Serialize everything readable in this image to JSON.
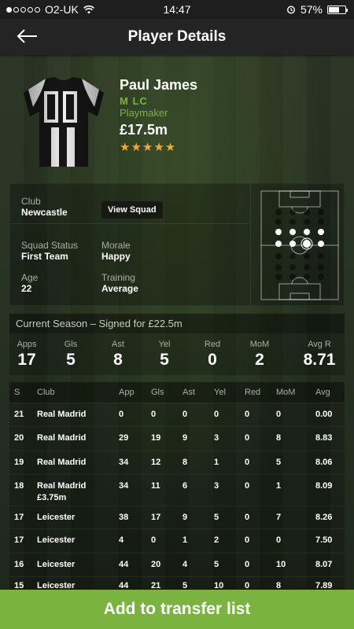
{
  "status_bar": {
    "carrier": "O2-UK",
    "time": "14:47",
    "battery": "57%"
  },
  "nav": {
    "title": "Player Details"
  },
  "player": {
    "shirt_number": "11",
    "name": "Paul James",
    "position": "M LC",
    "role": "Playmaker",
    "value": "£17.5m",
    "rating_stars": "★★★★★"
  },
  "info": {
    "club_label": "Club",
    "club": "Newcastle",
    "view_squad": "View Squad",
    "squad_status_label": "Squad Status",
    "squad_status": "First Team",
    "morale_label": "Morale",
    "morale": "Happy",
    "age_label": "Age",
    "age": "22",
    "training_label": "Training",
    "training": "Average"
  },
  "season": {
    "heading": "Current Season – Signed for £22.5m",
    "stats": [
      {
        "label": "Apps",
        "value": "17"
      },
      {
        "label": "Gls",
        "value": "5"
      },
      {
        "label": "Ast",
        "value": "8"
      },
      {
        "label": "Yel",
        "value": "5"
      },
      {
        "label": "Red",
        "value": "0"
      },
      {
        "label": "MoM",
        "value": "2"
      },
      {
        "label": "Avg R",
        "value": "8.71"
      }
    ]
  },
  "history": {
    "headers": {
      "s": "S",
      "club": "Club",
      "app": "App",
      "gls": "Gls",
      "ast": "Ast",
      "yel": "Yel",
      "red": "Red",
      "mom": "MoM",
      "avg": "Avg"
    },
    "rows": [
      {
        "s": "21",
        "club": "Real Madrid",
        "fee": "",
        "app": "0",
        "gls": "0",
        "ast": "0",
        "yel": "0",
        "red": "0",
        "mom": "0",
        "avg": "0.00"
      },
      {
        "s": "20",
        "club": "Real Madrid",
        "fee": "",
        "app": "29",
        "gls": "19",
        "ast": "9",
        "yel": "3",
        "red": "0",
        "mom": "8",
        "avg": "8.83"
      },
      {
        "s": "19",
        "club": "Real Madrid",
        "fee": "",
        "app": "34",
        "gls": "12",
        "ast": "8",
        "yel": "1",
        "red": "0",
        "mom": "5",
        "avg": "8.06"
      },
      {
        "s": "18",
        "club": "Real Madrid",
        "fee": "£3.75m",
        "app": "34",
        "gls": "11",
        "ast": "6",
        "yel": "3",
        "red": "0",
        "mom": "1",
        "avg": "8.09"
      },
      {
        "s": "17",
        "club": "Leicester",
        "fee": "",
        "app": "38",
        "gls": "17",
        "ast": "9",
        "yel": "5",
        "red": "0",
        "mom": "7",
        "avg": "8.26"
      },
      {
        "s": "17",
        "club": "Leicester",
        "fee": "",
        "app": "4",
        "gls": "0",
        "ast": "1",
        "yel": "2",
        "red": "0",
        "mom": "0",
        "avg": "7.50"
      },
      {
        "s": "16",
        "club": "Leicester",
        "fee": "",
        "app": "44",
        "gls": "20",
        "ast": "4",
        "yel": "5",
        "red": "0",
        "mom": "10",
        "avg": "8.07"
      },
      {
        "s": "15",
        "club": "Leicester",
        "fee": "",
        "app": "44",
        "gls": "21",
        "ast": "5",
        "yel": "10",
        "red": "0",
        "mom": "8",
        "avg": "7.89"
      }
    ]
  },
  "actions": {
    "add_to_transfer_list": "Add to transfer list"
  },
  "colors": {
    "accent_green": "#7bb341",
    "star": "#f0a830",
    "nav_bg": "#242424"
  }
}
